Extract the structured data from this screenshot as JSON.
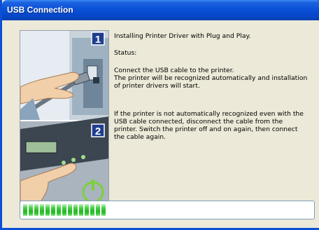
{
  "window": {
    "title": "USB Connection"
  },
  "messages": {
    "heading": "Installing Printer Driver with Plug and Play.",
    "status_label": "Status:",
    "step1_line1": "Connect the USB cable to the printer.",
    "step1_line2": "The printer will be recognized automatically and installation",
    "step1_line3": "of printer drivers will start.",
    "step2_line1": "If the printer is not automatically recognized even with the",
    "step2_line2": "USB cable connected, disconnect the cable from the",
    "step2_line3": "printer. Switch the printer off and on again, then connect",
    "step2_line4": "the cable again."
  },
  "illustration": {
    "step1_number": "1",
    "step2_number": "2"
  },
  "progress": {
    "fraction": 0.36,
    "segments": 15,
    "fill_color": "#2fbf2f"
  }
}
